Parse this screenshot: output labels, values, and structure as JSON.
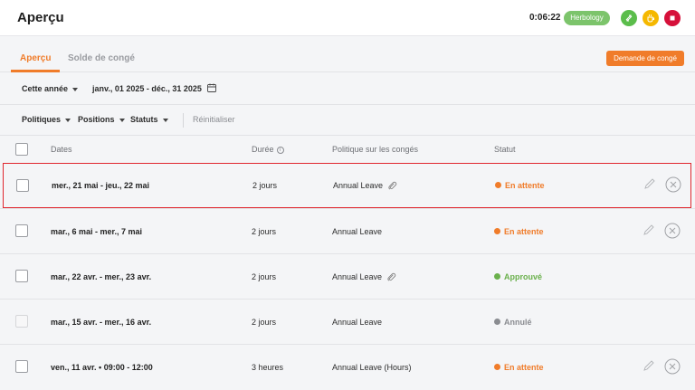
{
  "header": {
    "title": "Aperçu",
    "timer": "0:06:22",
    "project": "Herbology",
    "colors": {
      "green": "#5bbd4b",
      "yellow": "#f5b800",
      "red": "#d6103a",
      "accent": "#f07c2a"
    }
  },
  "tabs": [
    {
      "label": "Aperçu",
      "active": true
    },
    {
      "label": "Solde de congé",
      "active": false
    }
  ],
  "request_button": "Demande de congé",
  "period": {
    "label": "Cette année",
    "range": "janv., 01 2025 - déc., 31 2025"
  },
  "filters": {
    "policies": "Politiques",
    "positions": "Positions",
    "statuses": "Statuts",
    "reset": "Réinitialiser"
  },
  "table": {
    "headers": {
      "dates": "Dates",
      "duration": "Durée",
      "policy": "Politique sur les congés",
      "status": "Statut"
    },
    "rows": [
      {
        "dates": "mer., 21 mai - jeu., 22 mai",
        "duration": "2 jours",
        "policy": "Annual Leave",
        "attachment": true,
        "status": "En attente",
        "status_kind": "pending",
        "actions": true,
        "selected": true
      },
      {
        "dates": "mar., 6 mai - mer., 7 mai",
        "duration": "2 jours",
        "policy": "Annual Leave",
        "attachment": false,
        "status": "En attente",
        "status_kind": "pending",
        "actions": true,
        "selected": false
      },
      {
        "dates": "mar., 22 avr. - mer., 23 avr.",
        "duration": "2 jours",
        "policy": "Annual Leave",
        "attachment": true,
        "status": "Approuvé",
        "status_kind": "approved",
        "actions": false,
        "selected": false
      },
      {
        "dates": "mar., 15 avr. - mer., 16 avr.",
        "duration": "2 jours",
        "policy": "Annual Leave",
        "attachment": false,
        "status": "Annulé",
        "status_kind": "cancelled",
        "actions": false,
        "selected": false
      },
      {
        "dates": "ven., 11 avr. • 09:00 - 12:00",
        "duration": "3 heures",
        "policy": "Annual Leave (Hours)",
        "attachment": false,
        "status": "En attente",
        "status_kind": "pending",
        "actions": true,
        "selected": false
      }
    ]
  }
}
